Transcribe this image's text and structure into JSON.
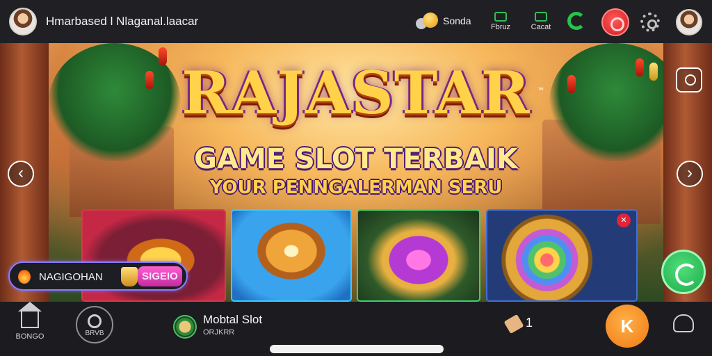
{
  "topbar": {
    "username": "Hmarbased l Nlaganal.laacar",
    "coins_label": "Sonda",
    "news_label": "Fbruz",
    "contact_label": "Cacat"
  },
  "banner": {
    "title": "RAJASTAR",
    "trademark": "™",
    "subtitle": "GAME SLOT TERBAIK",
    "tagline": "YOUR PENNGALERMAN SERU",
    "nav_prev": "‹",
    "nav_next": "›"
  },
  "promo": {
    "label": "NAGIGOHAN",
    "button": "SIGEIO"
  },
  "cards": [
    {
      "name": "golden-lamp"
    },
    {
      "name": "lion-mask"
    },
    {
      "name": "purple-pot"
    },
    {
      "name": "rainbow-medallion",
      "badge": "✕"
    }
  ],
  "bottombar": {
    "home_label": "BONGO",
    "center_label": "BRVB",
    "slot_title": "Mobtal Slot",
    "slot_sub": "ORJKRR",
    "ticket_count": "1",
    "fab_label": "K"
  },
  "colors": {
    "accent_green": "#27c24c",
    "accent_red": "#d31b1b",
    "accent_orange": "#f07a10",
    "promo_pink": "#c42a9f",
    "title_gold": "#ffd24a"
  }
}
